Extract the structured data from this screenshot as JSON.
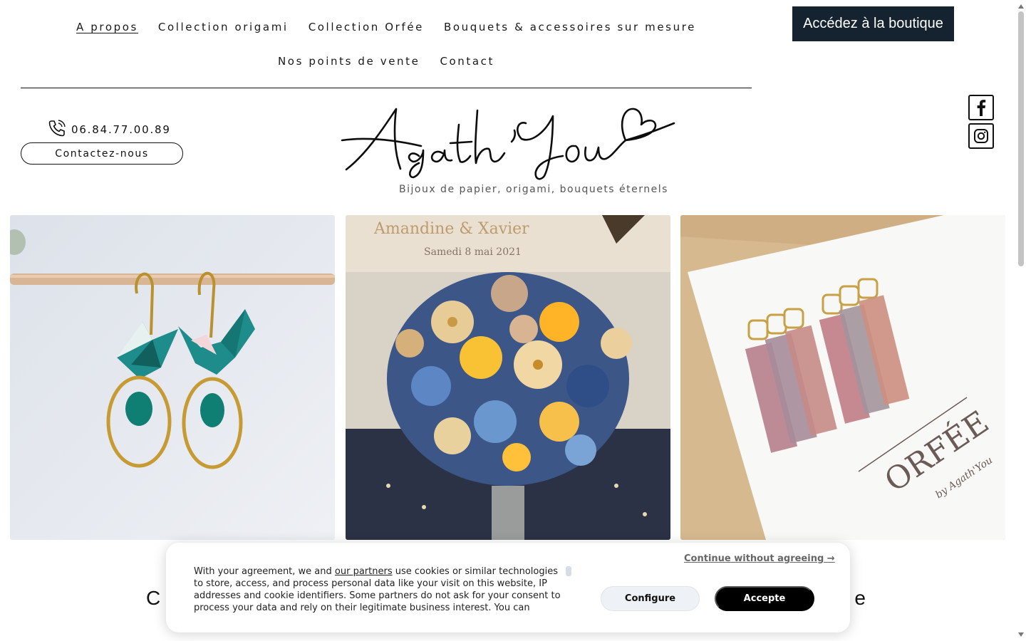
{
  "nav": {
    "row1": [
      {
        "label": "A propos",
        "active": true
      },
      {
        "label": "Collection origami",
        "active": false
      },
      {
        "label": "Collection Orfée",
        "active": false
      },
      {
        "label": "Bouquets & accessoires sur mesure",
        "active": false
      }
    ],
    "row2": [
      {
        "label": "Nos points de vente",
        "active": false
      },
      {
        "label": "Contact",
        "active": false
      }
    ]
  },
  "shop_button": "Accédez à la boutique",
  "social": [
    "facebook-icon",
    "instagram-icon"
  ],
  "contact": {
    "phone": "06.84.77.00.89",
    "button": "Contactez-nous"
  },
  "logo": {
    "text": "Agath'You",
    "tagline": "Bijoux de papier, origami, bouquets éternels"
  },
  "gallery": [
    {
      "name": "origami-crane-earrings-photo"
    },
    {
      "name": "paper-flower-bouquet-photo",
      "text": "Amandine & Xavier — Samedi 8 mai 2021"
    },
    {
      "name": "orfee-earrings-photo",
      "text": "ORFÉE by Agath'You"
    }
  ],
  "section_heading": {
    "start": "C",
    "end": "e"
  },
  "cookie": {
    "text_before_link": "With your agreement, we and ",
    "link": "our partners",
    "text_after_link": " use cookies or similar technologies to store, access, and process personal data like your visit on this website, IP addresses and cookie identifiers. Some partners do not ask for your consent to process your data and rely on their legitimate business interest. You can",
    "continue": "Continue without agreeing →",
    "configure": "Configure",
    "accept": "Accepte"
  },
  "colors": {
    "shop_button_bg": "#14232f",
    "accept_bg": "#000000",
    "configure_bg": "#eef1f5"
  }
}
